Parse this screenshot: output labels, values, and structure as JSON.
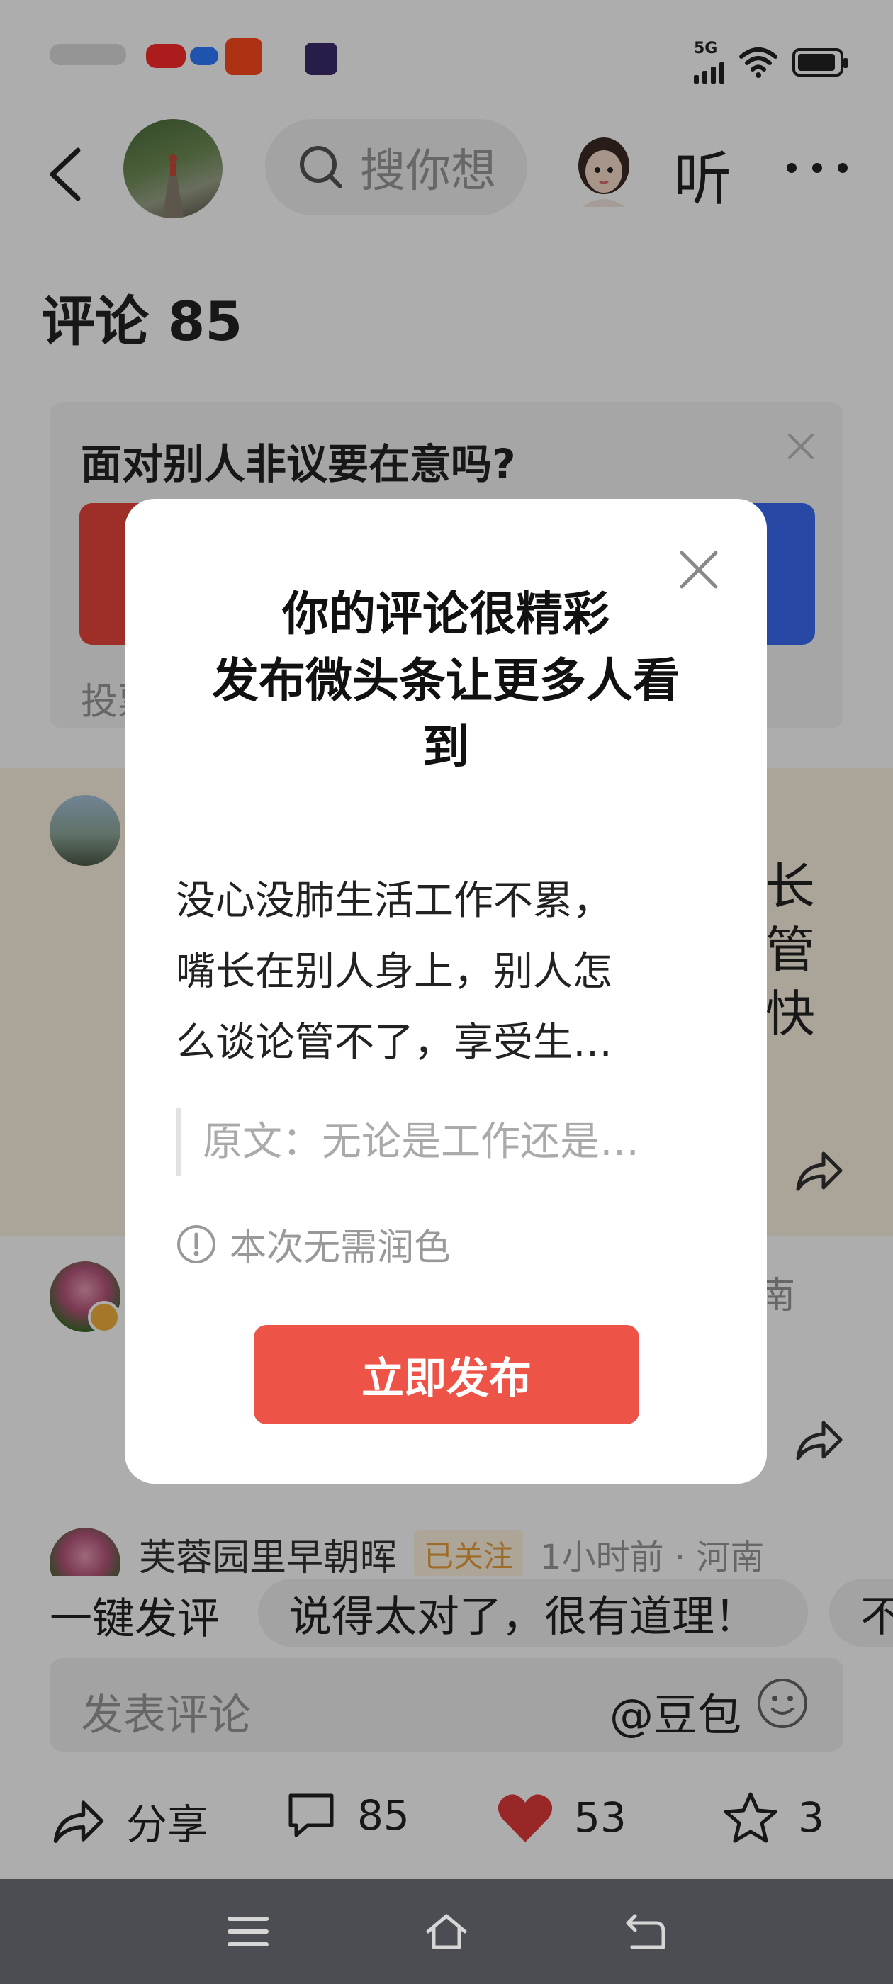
{
  "status_bar": {
    "network": "5G"
  },
  "header": {
    "search_placeholder": "搜你想",
    "listen_label": "听"
  },
  "comments": {
    "title": "评论 85",
    "poll": {
      "question": "面对别人非议要在意吗?",
      "footer": "投票"
    },
    "visible_fragments": {
      "first_comment_right": "长管快",
      "second_comment_meta_right": "南"
    },
    "third_comment": {
      "name": "芙蓉园里早朝晖",
      "follow_badge": "已关注",
      "meta": "1小时前 · 河南"
    }
  },
  "quick_reply": {
    "label": "一键发评",
    "chips": [
      "说得太对了，很有道理！",
      "不"
    ]
  },
  "comment_input": {
    "placeholder": "发表评论",
    "doubao": "@豆包"
  },
  "actions": {
    "share_label": "分享",
    "comment_count": "85",
    "like_count": "53",
    "favorite_count": "3"
  },
  "modal": {
    "title_line1": "你的评论很精彩",
    "title_line2": "发布微头条让更多人看",
    "title_line3": "到",
    "body_line1": "没心没肺生活工作不累，",
    "body_line2": "嘴长在别人身上，别人怎",
    "body_line3": "么谈论管不了，享受生…",
    "quote": "原文：无论是工作还是…",
    "tip": "本次无需润色",
    "publish_button": "立即发布"
  },
  "colors": {
    "accent_red": "#ed5347",
    "like_red": "#e33a3a",
    "poll_blue": "#3a6cf4",
    "nav_bar": "#4b4d52"
  }
}
